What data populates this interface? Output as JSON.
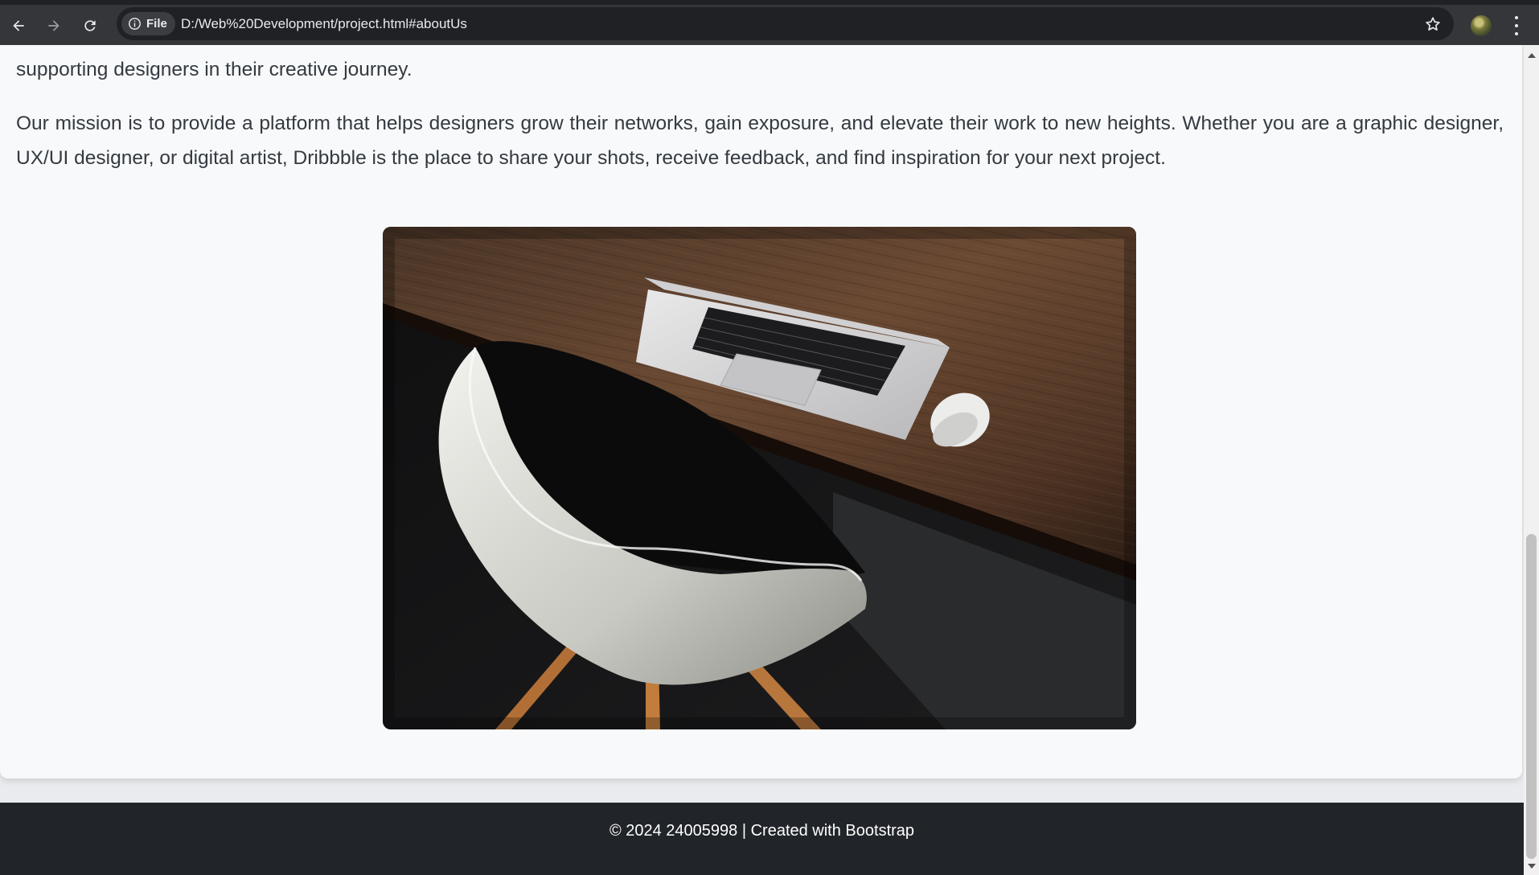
{
  "browser": {
    "back_icon": "arrow-left-icon",
    "forward_icon": "arrow-right-icon",
    "reload_icon": "reload-icon",
    "site_info_icon": "info-circle-icon",
    "site_chip_label": "File",
    "url": "D:/Web%20Development/project.html#aboutUs",
    "bookmark_icon": "star-icon",
    "profile_icon": "avatar",
    "menu_icon": "kebab-menu-icon"
  },
  "about": {
    "paragraph_1_tail": "supporting designers in their creative journey.",
    "paragraph_2": "Our mission is to provide a platform that helps designers grow their networks, gain exposure, and elevate their work to new heights. Whether you are a graphic designer, UX/UI designer, or digital artist, Dribbble is the place to share your shots, receive feedback, and find inspiration for your next project.",
    "image_subject": "desk-laptop-chair-photo"
  },
  "footer": {
    "text": "© 2024 24005998 | Created with Bootstrap"
  },
  "colors": {
    "chrome_bg": "#35363a",
    "omnibox_bg": "#202124",
    "page_bg": "#f8f9fa",
    "body_text": "#333a40",
    "footer_bg": "#212529",
    "footer_text": "#ffffff"
  }
}
